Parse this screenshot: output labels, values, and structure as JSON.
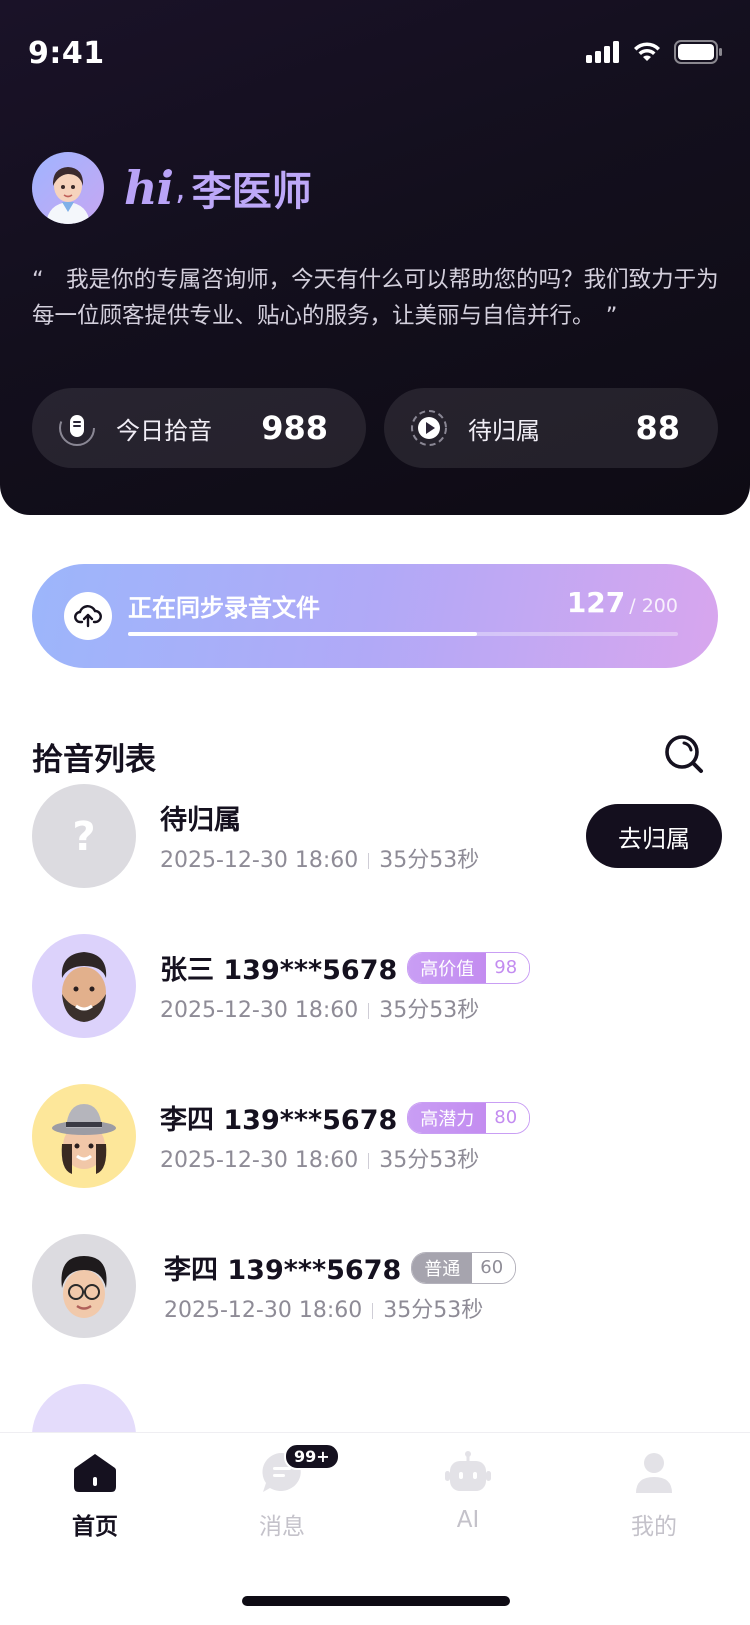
{
  "status_bar": {
    "time": "9:41"
  },
  "greeting": {
    "hi": "hi",
    "comma": ",",
    "doctor_name": "李医师"
  },
  "intro": {
    "text": "“　我是你的专属咨询师，今天有什么可以帮助您的吗？我们致力于为每一位顾客提供专业、贴心的服务，让美丽与自信并行。　”"
  },
  "stats": [
    {
      "label": "今日拾音",
      "value": "988",
      "icon": "microphone-icon"
    },
    {
      "label": "待归属",
      "value": "88",
      "icon": "play-circle-icon"
    }
  ],
  "sync": {
    "label": "正在同步录音文件",
    "current": "127",
    "total": "/ 200",
    "progress": 0.635,
    "icon": "cloud-upload-icon"
  },
  "section": {
    "title": "拾音列表",
    "search_icon": "search-icon"
  },
  "records": [
    {
      "name": "待归属",
      "date": "2025-12-30 18:60",
      "duration": "35分53秒",
      "action": "去归属",
      "avatar": "question-mark"
    },
    {
      "name": "张三 139***5678",
      "date": "2025-12-30 18:60",
      "duration": "35分53秒",
      "tag": "高价值",
      "score": "98",
      "tag_style": "purple"
    },
    {
      "name": "李四 139***5678",
      "date": "2025-12-30 18:60",
      "duration": "35分53秒",
      "tag": "高潜力",
      "score": "80",
      "tag_style": "purple"
    },
    {
      "name": "李四 139***5678",
      "date": "2025-12-30  18:60",
      "duration": "35分53秒",
      "tag": "普通",
      "score": "60",
      "tag_style": "gray"
    }
  ],
  "tabbar": {
    "tabs": [
      {
        "label": "首页",
        "icon": "home-icon",
        "active": true
      },
      {
        "label": "消息",
        "icon": "message-icon",
        "badge": "99+"
      },
      {
        "label": "AI",
        "icon": "robot-icon"
      },
      {
        "label": "我的",
        "icon": "user-icon"
      }
    ]
  },
  "colors": {
    "accent_purple": "#c38cf0",
    "dark": "#140f1e",
    "header_bg": "#130f1d"
  }
}
